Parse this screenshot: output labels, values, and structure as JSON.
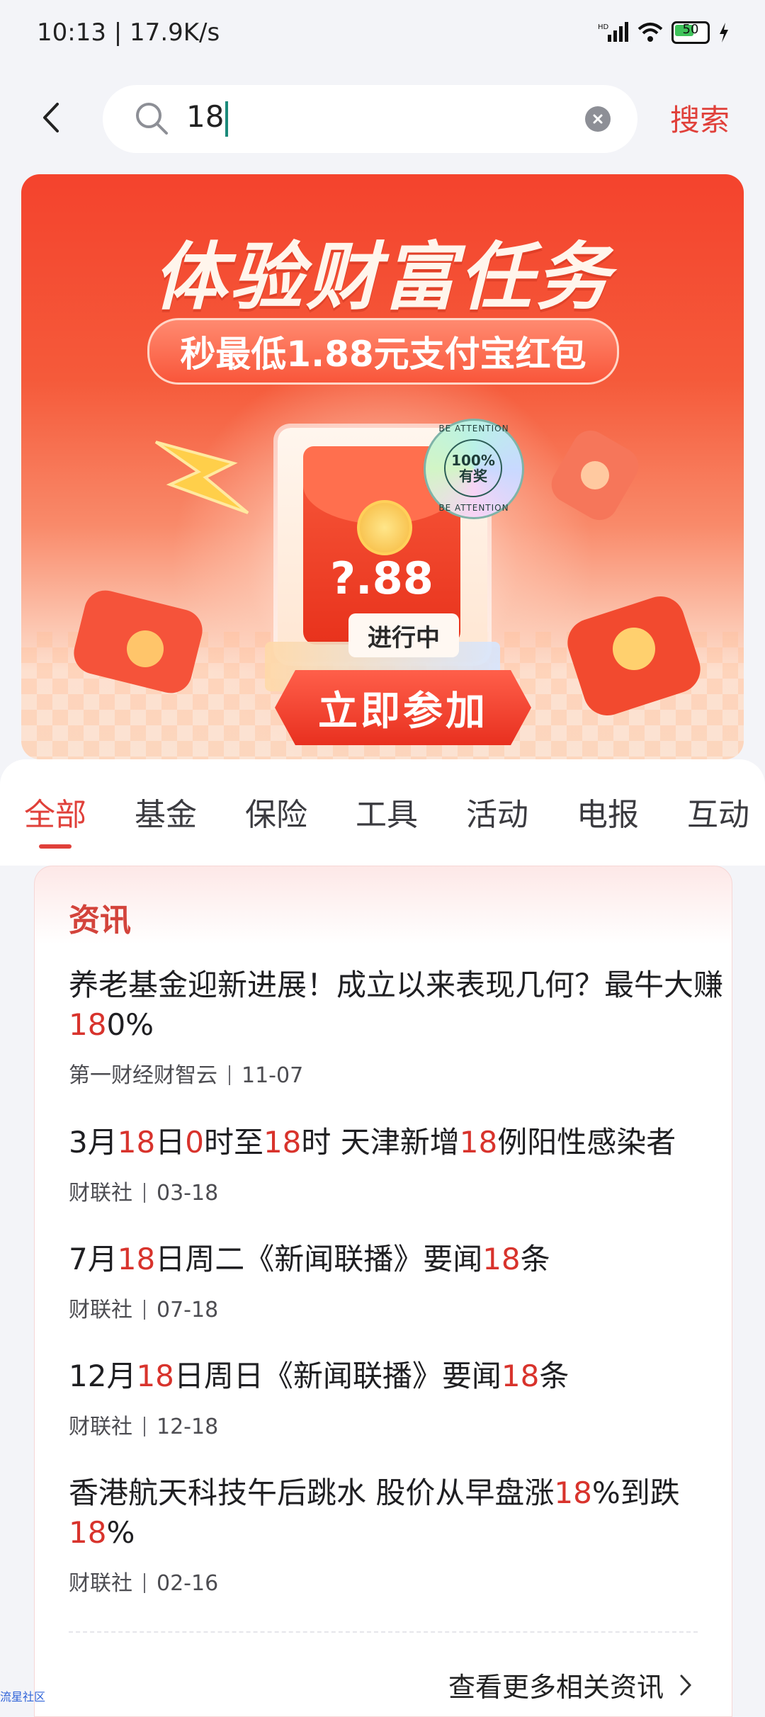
{
  "status_bar": {
    "time": "10:13 | 17.9K/s",
    "battery": "50",
    "icons": [
      "hd-icon",
      "signal-icon",
      "wifi-icon",
      "battery-icon",
      "charging-icon"
    ]
  },
  "search": {
    "value": "18",
    "button_label": "搜索"
  },
  "banner": {
    "title": "体验财富任务",
    "subtitle": "秒最低1.88元支付宝红包",
    "amount": "?.88",
    "status": "进行中",
    "cta": "立即参加",
    "stamp_text": "100%",
    "stamp_text2": "有奖",
    "stamp_ring": "BE ATTENTION"
  },
  "tabs": [
    {
      "label": "全部",
      "active": true
    },
    {
      "label": "基金"
    },
    {
      "label": "保险"
    },
    {
      "label": "工具"
    },
    {
      "label": "活动"
    },
    {
      "label": "电报"
    },
    {
      "label": "互动"
    }
  ],
  "news_section": {
    "title": "资讯",
    "items": [
      {
        "title": "养老基金迎新进展！成立以来表现几何？最牛大赚180%",
        "source": "第一财经财智云",
        "date": "11-07"
      },
      {
        "title": "3月18日0时至18时 天津新增18例阳性感染者",
        "source": "财联社",
        "date": "03-18"
      },
      {
        "title": "7月18日周二《新闻联播》要闻18条",
        "source": "财联社",
        "date": "07-18"
      },
      {
        "title": "12月18日周日《新闻联播》要闻18条",
        "source": "财联社",
        "date": "12-18"
      },
      {
        "title": "香港航天科技午后跳水 股价从早盘涨18%到跌18%",
        "source": "财联社",
        "date": "02-16"
      }
    ],
    "more_label": "查看更多相关资讯"
  },
  "watermark": "流星社区",
  "colors": {
    "accent": "#e0403a",
    "highlight": "#d8332c",
    "page_bg": "#f3f4f8"
  }
}
